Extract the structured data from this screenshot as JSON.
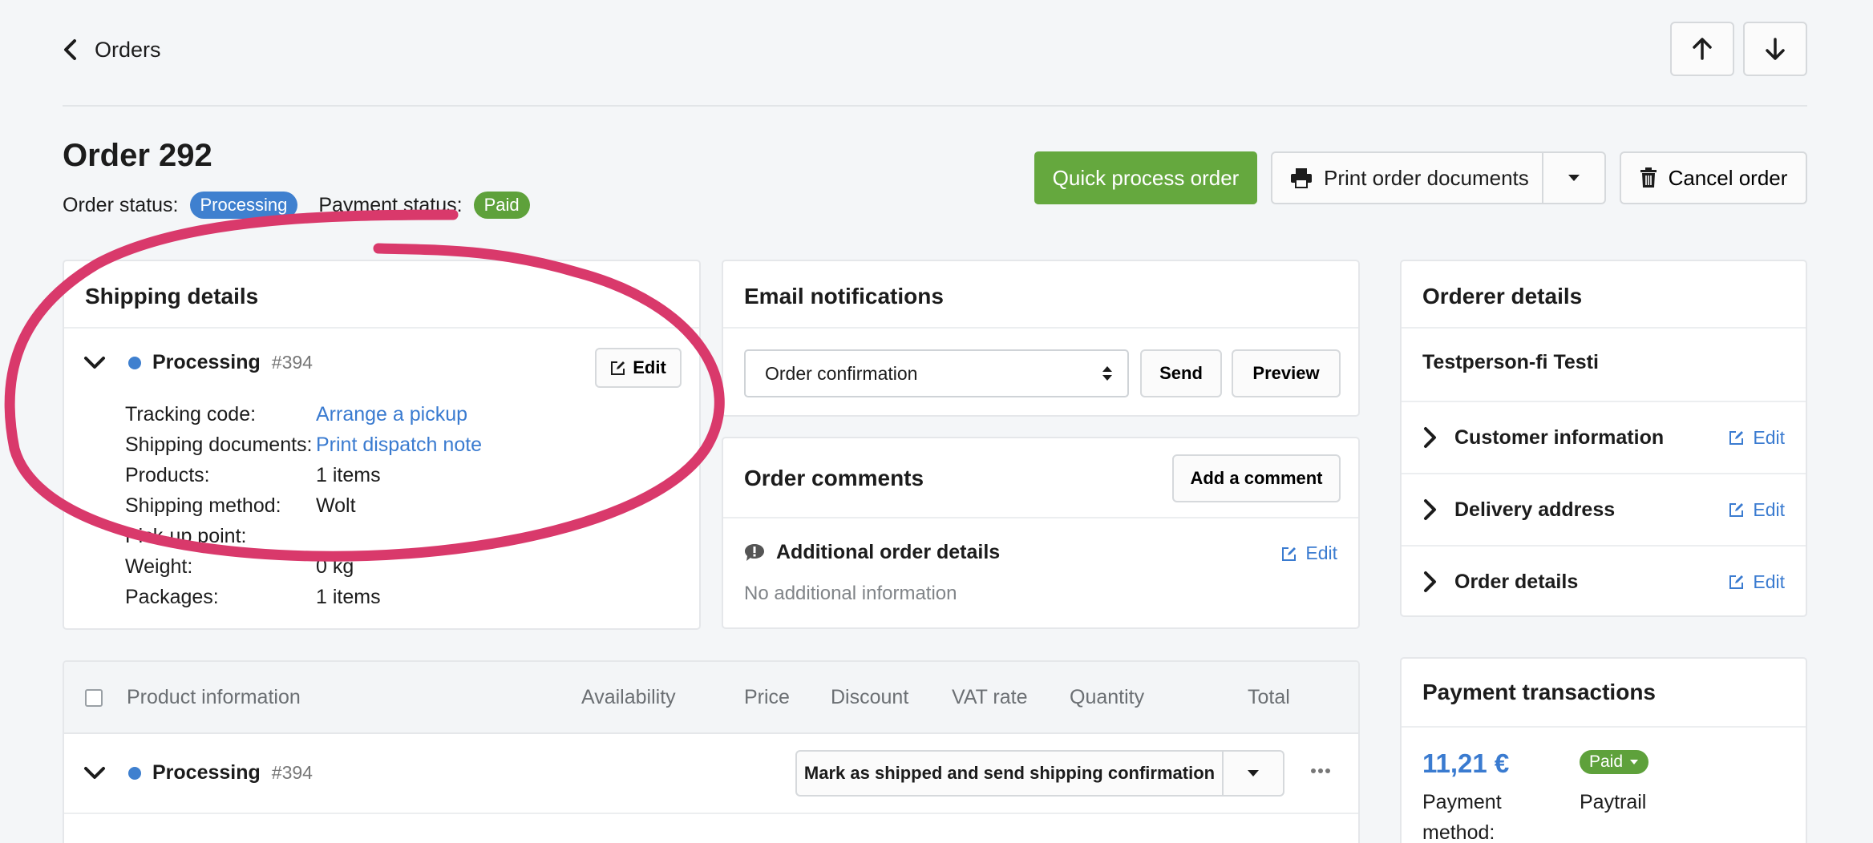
{
  "header": {
    "back_label": "Orders",
    "order_title": "Order 292",
    "order_status_label": "Order status:",
    "order_status": "Processing",
    "payment_status_label": "Payment status:",
    "payment_status": "Paid"
  },
  "actions": {
    "quick_process": "Quick process order",
    "print_docs": "Print order documents",
    "cancel": "Cancel order"
  },
  "colors": {
    "primary_green": "#65a83e",
    "status_blue": "#3f80cf",
    "link_blue": "#3a7bd0",
    "annotation_pink": "#d9396b"
  },
  "shipping": {
    "title": "Shipping details",
    "status": "Processing",
    "number": "#394",
    "edit": "Edit",
    "rows": [
      {
        "label": "Tracking code:",
        "value": "Arrange a pickup",
        "link": true
      },
      {
        "label": "Shipping documents:",
        "value": "Print dispatch note",
        "link": true
      },
      {
        "label": "Products:",
        "value": "1 items"
      },
      {
        "label": "Shipping method:",
        "value": "Wolt"
      },
      {
        "label": "Pick-up point:",
        "value": ""
      },
      {
        "label": "Weight:",
        "value": "0 kg"
      },
      {
        "label": "Packages:",
        "value": "1 items"
      }
    ]
  },
  "email": {
    "title": "Email notifications",
    "selected": "Order confirmation",
    "send": "Send",
    "preview": "Preview"
  },
  "comments": {
    "title": "Order comments",
    "add": "Add a comment",
    "additional_title": "Additional order details",
    "edit": "Edit",
    "empty": "No additional information"
  },
  "orderer": {
    "title": "Orderer details",
    "name": "Testperson-fi Testi",
    "sections": [
      {
        "label": "Customer information",
        "edit": "Edit"
      },
      {
        "label": "Delivery address",
        "edit": "Edit"
      },
      {
        "label": "Order details",
        "edit": "Edit"
      }
    ]
  },
  "products": {
    "columns": [
      "Product information",
      "Availability",
      "Price",
      "Discount",
      "VAT rate",
      "Quantity",
      "Total"
    ],
    "group_status": "Processing",
    "group_number": "#394",
    "ship_action": "Mark as shipped and send shipping confirmation"
  },
  "payment": {
    "title": "Payment transactions",
    "amount": "11,21 €",
    "method_label": "Payment method:",
    "status": "Paid",
    "provider": "Paytrail"
  }
}
